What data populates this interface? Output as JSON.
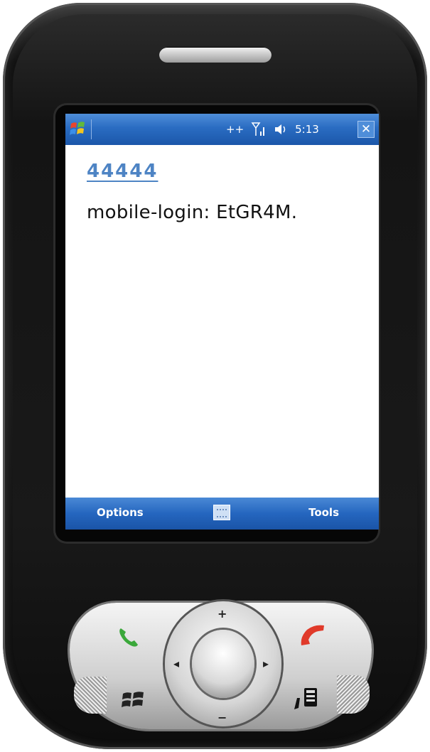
{
  "status_bar": {
    "signal_text": "++",
    "volume_text": "◂ᵎ",
    "time": "5:13",
    "close_label": "✕"
  },
  "message": {
    "sender": "44444",
    "body": "mobile-login: EtGR4M."
  },
  "soft_keys": {
    "left": "Options",
    "right": "Tools"
  },
  "dpad": {
    "up": "+",
    "down": "−",
    "left": "◂",
    "right": "▸"
  },
  "colors": {
    "status_bar": "#2a6cc2",
    "sender_link": "#4e84c4",
    "call_green": "#3aa83a",
    "end_red": "#e03a2a"
  },
  "icons": {
    "start": "windows-flag-icon",
    "signal": "signal-icon",
    "volume": "volume-icon",
    "keyboard": "keyboard-icon",
    "call": "call-icon",
    "end": "end-call-icon",
    "windows_key": "windows-key-icon",
    "ok_key": "ok-key-icon"
  }
}
